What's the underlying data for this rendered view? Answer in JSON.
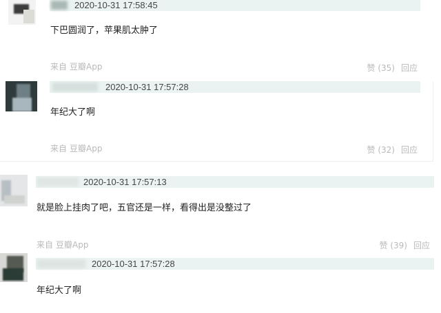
{
  "comments": [
    {
      "timestamp": "2020-10-31 17:58:45",
      "content": "下巴圆润了，苹果肌太肿了",
      "source_prefix": "来自",
      "source_app": "豆瓣App",
      "like_label": "赞",
      "like_count": "(35)",
      "reply_label": "回应"
    },
    {
      "timestamp": "2020-10-31 17:57:28",
      "content": "年纪大了啊",
      "source_prefix": "来自",
      "source_app": "豆瓣App",
      "like_label": "赞",
      "like_count": "(32)",
      "reply_label": "回应"
    },
    {
      "timestamp": "2020-10-31 17:57:13",
      "content": "就是脸上挂肉了吧，五官还是一样，看得出是没整过了",
      "source_prefix": "来自",
      "source_app": "豆瓣App",
      "like_label": "赞",
      "like_count": "(39)",
      "reply_label": "回应"
    },
    {
      "timestamp": "2020-10-31 17:57:28",
      "content": "年纪大了啊"
    }
  ],
  "colors": {
    "meta_bar": "#eaf3f1",
    "muted_text": "#b9b9b9"
  }
}
